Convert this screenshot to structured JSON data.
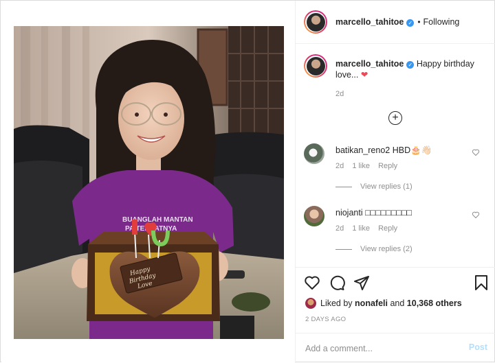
{
  "post": {
    "author": "marcello_tahitoe",
    "follow_status": "Following",
    "separator": "•",
    "caption_text": "Happy birthday love...",
    "caption_heart": "❤",
    "caption_time": "2d",
    "load_more_symbol": "+",
    "photo_alt_lettering": "BUANGLAH MANTAN PADA TEMPATNYA",
    "cake_topper": "I ♥ U",
    "cake_plaque": "Happy Birthday Love"
  },
  "comments": [
    {
      "username": "batikan_reno2",
      "text": "HBD🎂👋🏻",
      "time": "2d",
      "likes": "1 like",
      "reply": "Reply",
      "view_replies": "View replies (1)"
    },
    {
      "username": "niojanti",
      "text": "□□□□□□□□□",
      "time": "2d",
      "likes": "1 like",
      "reply": "Reply",
      "view_replies": "View replies (2)"
    }
  ],
  "likes": {
    "prefix": "Liked by",
    "user": "nonafeli",
    "conj": "and",
    "others": "10,368 others"
  },
  "date": "2 DAYS AGO",
  "comment_box": {
    "placeholder": "Add a comment...",
    "post_label": "Post"
  },
  "colors": {
    "verified": "#3897f0",
    "heart": "#ed4956",
    "muted": "#8e8e8e",
    "post_button_disabled": "#b2dffc",
    "shirt": "#7b2a8c"
  },
  "icons": [
    "verified-badge-icon",
    "plus-circle-icon",
    "heart-icon",
    "comment-icon",
    "share-icon",
    "bookmark-icon"
  ]
}
